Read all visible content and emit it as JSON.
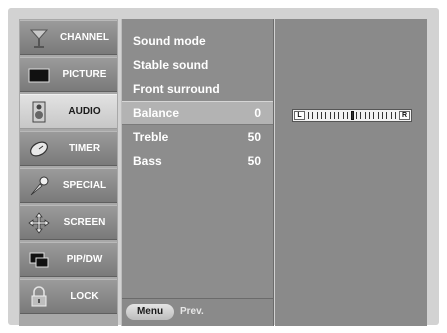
{
  "menu": [
    {
      "label": "CHANNEL",
      "icon": "antenna-icon"
    },
    {
      "label": "PICTURE",
      "icon": "picture-icon"
    },
    {
      "label": "AUDIO",
      "icon": "speaker-icon",
      "selected": true
    },
    {
      "label": "TIMER",
      "icon": "clock-icon"
    },
    {
      "label": "SPECIAL",
      "icon": "special-icon"
    },
    {
      "label": "SCREEN",
      "icon": "screen-move-icon"
    },
    {
      "label": "PIP/DW",
      "icon": "pip-icon"
    },
    {
      "label": "LOCK",
      "icon": "lock-icon"
    }
  ],
  "audio_menu": {
    "items": [
      {
        "name": "Sound mode",
        "value": ""
      },
      {
        "name": "Stable sound",
        "value": ""
      },
      {
        "name": "Front surround",
        "value": ""
      },
      {
        "name": "Balance",
        "value": "0",
        "selected": true
      },
      {
        "name": "Treble",
        "value": "50"
      },
      {
        "name": "Bass",
        "value": "50"
      }
    ],
    "footer": {
      "menu_label": "Menu",
      "prev_label": "Prev."
    }
  },
  "balance_slider": {
    "left_label": "L",
    "right_label": "R",
    "level_fraction": 0.5
  },
  "colors": {
    "background": "#d2d2d2",
    "menu_selected": "#d6d6d6",
    "panel": "#8d8d8d"
  }
}
